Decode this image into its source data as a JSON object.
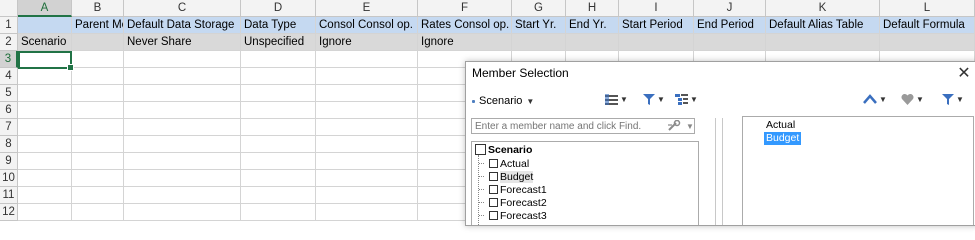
{
  "columns": [
    "A",
    "B",
    "C",
    "D",
    "E",
    "F",
    "G",
    "H",
    "I",
    "J",
    "K",
    "L"
  ],
  "row_numbers": [
    "1",
    "2",
    "3",
    "4",
    "5",
    "6",
    "7",
    "8",
    "9",
    "10",
    "11",
    "12"
  ],
  "row1": [
    "",
    "Parent Member",
    "Default Data Storage",
    "Data Type",
    "Consol Consol op.",
    "Rates Consol op.",
    "Start Yr.",
    "End Yr.",
    "Start Period",
    "End Period",
    "Default Alias Table",
    "Default Formula"
  ],
  "row2": [
    "Scenario",
    "",
    "Never Share",
    "Unspecified",
    "Ignore",
    "Ignore",
    "",
    "",
    "",
    "",
    "",
    ""
  ],
  "dialog": {
    "title": "Member Selection",
    "close": "✕",
    "dimension": "Scenario",
    "search_placeholder": "Enter a member name and click Find.",
    "tree_root": "Scenario",
    "tree_children": [
      "Actual",
      "Budget",
      "Forecast1",
      "Forecast2",
      "Forecast3"
    ],
    "selected": [
      "Actual",
      "Budget"
    ],
    "selected_highlight": "Budget"
  },
  "colors": {
    "header_blue": "#c5d9f1",
    "row_gray": "#d9d9d9",
    "excel_green": "#217346",
    "highlight_blue": "#3399ff"
  },
  "icons": [
    "filter-icon",
    "grid-icon",
    "layout-icon",
    "member-type-icon",
    "chevron-up-icon",
    "heart-icon",
    "find-icon"
  ]
}
